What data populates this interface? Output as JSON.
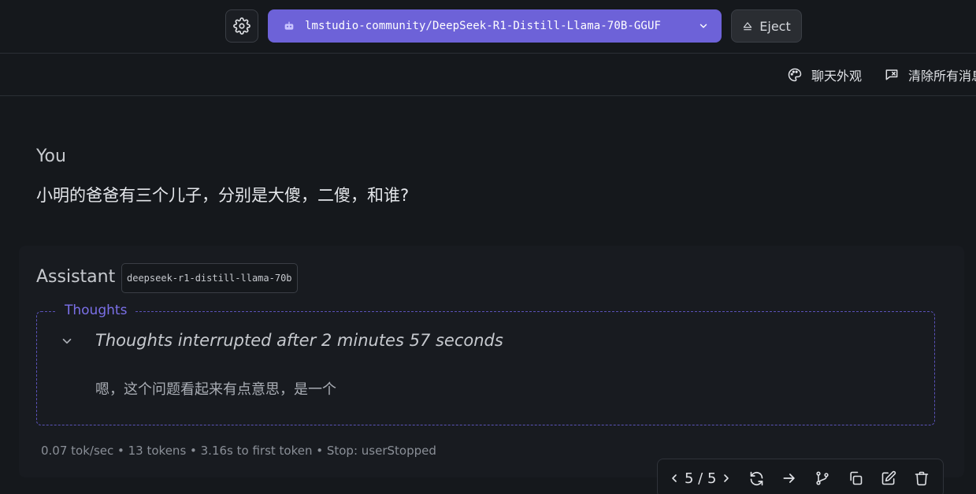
{
  "header": {
    "model_selector": "lmstudio-community/DeepSeek-R1-Distill-Llama-70B-GGUF",
    "eject_label": "Eject"
  },
  "toolbar": {
    "chat_appearance": "聊天外观",
    "clear_all": "清除所有消息"
  },
  "user_message": {
    "role": "You",
    "text": "小明的爸爸有三个儿子，分别是大傻，二傻，和谁?"
  },
  "assistant_message": {
    "role": "Assistant",
    "model_tag": "deepseek-r1-distill-llama-70b",
    "thoughts_legend": "Thoughts",
    "thoughts_title": "Thoughts interrupted after 2 minutes 57 seconds",
    "thoughts_body": "嗯，这个问题看起来有点意思，是一个",
    "stats": "0.07 tok/sec • 13 tokens • 3.16s to first token • Stop: userStopped"
  },
  "pager": {
    "label": "5 / 5"
  },
  "colors": {
    "accent": "#6d62d8",
    "thoughts_accent": "#7b70e8",
    "background": "#15181c"
  }
}
